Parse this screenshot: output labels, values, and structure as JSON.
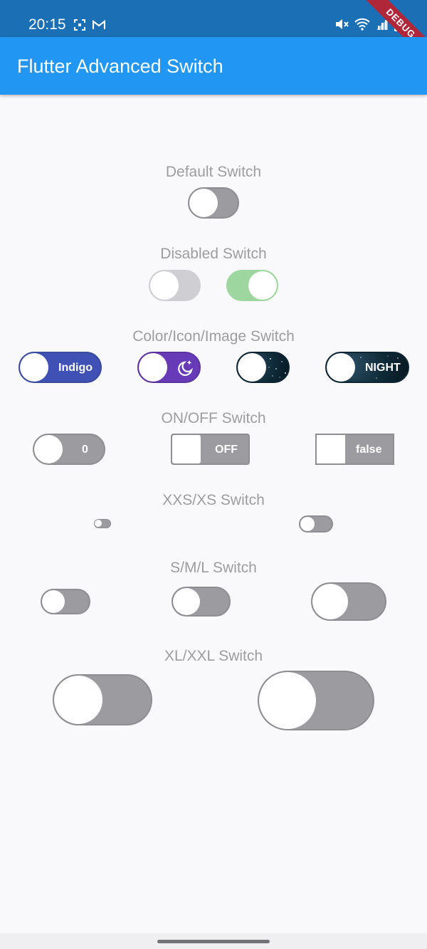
{
  "status_bar": {
    "time": "20:15",
    "debug_label": "DEBUG",
    "icons": [
      "screenshot-icon",
      "gmail-icon",
      "mute-icon",
      "wifi-icon",
      "signal-icon",
      "battery-icon"
    ]
  },
  "app_bar": {
    "title": "Flutter Advanced Switch"
  },
  "sections": {
    "default": "Default Switch",
    "disabled": "Disabled Switch",
    "color": "Color/Icon/Image Switch",
    "onoff": "ON/OFF Switch",
    "xxs": "XXS/XS Switch",
    "sml": "S/M/L Switch",
    "xl": "XL/XXL Switch"
  },
  "switch_labels": {
    "indigo": "Indigo",
    "night": "NIGHT",
    "zero": "0",
    "off": "OFF",
    "false_text": "false"
  },
  "switch_states": {
    "default": false,
    "disabled_off": false,
    "disabled_on": true,
    "indigo": false,
    "purple_icon": false,
    "starry_image": false,
    "night": false,
    "zero": false,
    "off": false,
    "false_switch": false,
    "xxs": false,
    "xs": false,
    "small": false,
    "medium": false,
    "large": false,
    "xl": false,
    "xxl": false
  },
  "colors": {
    "status_bar": "#1a6fb5",
    "app_bar": "#2196f3",
    "inactive": "#9c9b9f",
    "disabled_on": "#9ed6a0",
    "indigo": "#3f51b5",
    "purple": "#673ab7",
    "section_label": "#9d9c9f"
  }
}
